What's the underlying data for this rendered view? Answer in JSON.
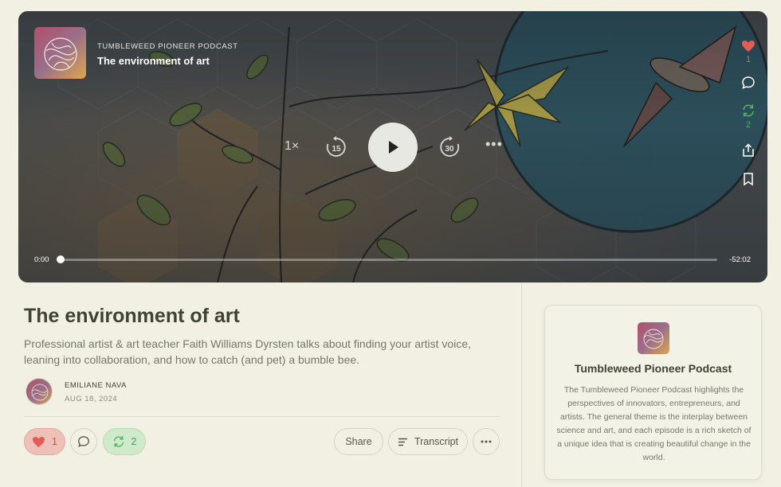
{
  "player": {
    "podcast_name": "TUMBLEWEED PIONEER PODCAST",
    "episode_title": "The environment of art",
    "speed": "1×",
    "skip_back": "15",
    "skip_forward": "30",
    "more": "•••",
    "time_elapsed": "0:00",
    "time_remaining": "-52:02",
    "progress": 0.0,
    "like_count": "1",
    "restack_count": "2",
    "icons": [
      "heart-icon",
      "comment-icon",
      "restack-icon",
      "share-icon",
      "bookmark-icon",
      "play-icon"
    ]
  },
  "episode": {
    "title": "The environment of art",
    "description": "Professional artist & art teacher Faith Williams Dyrsten talks about finding your artist voice, leaning into collaboration, and how to catch (and pet) a bumble bee.",
    "author": "EMILIANE NAVA",
    "date": "AUG 18, 2024"
  },
  "actions": {
    "like_count": "1",
    "restack_count": "2",
    "share_label": "Share",
    "transcript_label": "Transcript"
  },
  "podcast_card": {
    "title": "Tumbleweed Pioneer Podcast",
    "description": "The Tumbleweed Pioneer Podcast highlights the perspectives of innovators, entrepreneurs, and artists. The general theme is the interplay between science and art, and each episode is a rich sketch of a unique idea that is creating beautiful change in the world."
  },
  "colors": {
    "background": "#f1f0e3",
    "like": "#e35d55",
    "restack": "#4fb560",
    "text_dark": "#3f4334",
    "text_muted": "#76786a"
  }
}
